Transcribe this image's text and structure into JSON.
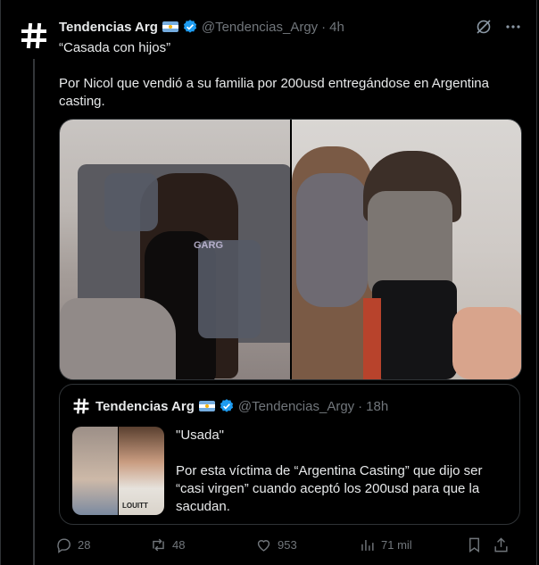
{
  "tweet": {
    "author_name": "Tendencias Arg",
    "handle": "@Tendencias_Argy",
    "separator": "·",
    "time": "4h",
    "paragraphs": [
      "“Casada con hijos”",
      "Por Nicol que vendió a su familia por 200usd entregándose en Argentina casting."
    ],
    "image_watermark": "GARG"
  },
  "quoted": {
    "author_name": "Tendencias Arg",
    "handle": "@Tendencias_Argy",
    "separator": "·",
    "time": "18h",
    "paragraphs": [
      "\"Usada\"",
      "Por esta víctima de “Argentina Casting” que dijo ser “casi virgen” cuando aceptó los 200usd para que la sacudan."
    ],
    "thumb_caption": "LOUITT"
  },
  "actions": {
    "replies": "28",
    "reposts": "48",
    "likes": "953",
    "views": "71 mil"
  },
  "colors": {
    "background": "#000000",
    "text": "#e7e9ea",
    "muted": "#71767b",
    "border": "#2f3336",
    "verified": "#1d9bf0"
  }
}
